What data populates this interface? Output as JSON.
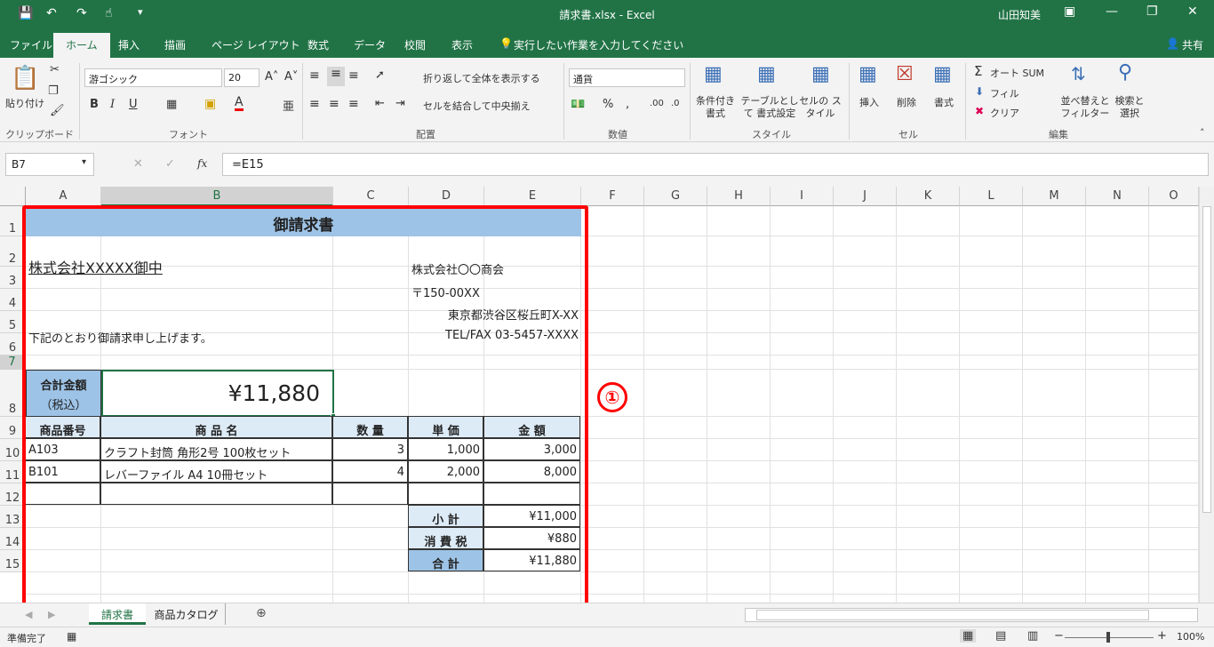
{
  "window": {
    "title": "請求書.xlsx - Excel",
    "user": "山田知美"
  },
  "tabs": [
    "ファイル",
    "ホーム",
    "挿入",
    "描画",
    "ページ レイアウト",
    "数式",
    "データ",
    "校閲",
    "表示"
  ],
  "tell_me": "実行したい作業を入力してください",
  "share": "共有",
  "ribbon": {
    "paste": "貼り付け",
    "font_name": "游ゴシック",
    "font_size": "20",
    "wrap": "折り返して全体を表示する",
    "merge": "セルを結合して中央揃え",
    "number_format": "通貨",
    "cond": "条件付き 書式",
    "table": "テーブルとして 書式設定",
    "cellstyle": "セルの スタイル",
    "insert": "挿入",
    "delete": "削除",
    "format": "書式",
    "autosum": "オート SUM",
    "fill": "フィル",
    "clear": "クリア",
    "sort": "並べ替えと フィルター",
    "find": "検索と 選択",
    "groups": [
      "クリップボード",
      "フォント",
      "配置",
      "数値",
      "スタイル",
      "セル",
      "編集"
    ]
  },
  "formula": {
    "namebox": "B7",
    "fx": "fx",
    "content": "=E15"
  },
  "columns": [
    "A",
    "B",
    "C",
    "D",
    "E",
    "F",
    "G",
    "H",
    "I",
    "J",
    "K",
    "L",
    "M",
    "N",
    "O"
  ],
  "rows": [
    "1",
    "2",
    "3",
    "4",
    "5",
    "6",
    "7",
    "8",
    "9",
    "10",
    "11",
    "12",
    "13",
    "14",
    "15"
  ],
  "sheet": {
    "title": "御請求書",
    "client": "株式会社XXXXX御中",
    "company": "株式会社〇〇商会",
    "zip": "〒150-00XX",
    "address": "東京都渋谷区桜丘町X-XX",
    "tel": "TEL/FAX 03-5457-XXXX",
    "intro": "下記のとおり御請求申し上げます。",
    "total_label1": "合計金額",
    "total_label2": "（税込）",
    "total_value": "¥11,880",
    "headers": [
      "商品番号",
      "商 品 名",
      "数 量",
      "単 価",
      "金 額"
    ],
    "items": [
      {
        "code": "A103",
        "name": "クラフト封筒 角形2号 100枚セット",
        "qty": "3",
        "price": "1,000",
        "amount": "3,000"
      },
      {
        "code": "B101",
        "name": "レバーファイル A4 10冊セット",
        "qty": "4",
        "price": "2,000",
        "amount": "8,000"
      }
    ],
    "subtotal_label": "小 計",
    "subtotal": "¥11,000",
    "tax_label": "消 費 税",
    "tax": "¥880",
    "grand_label": "合 計",
    "grand": "¥11,880"
  },
  "annotation": "①",
  "sheet_tabs": [
    "請求書",
    "商品カタログ"
  ],
  "status": {
    "ready": "準備完了",
    "zoom": "100%"
  }
}
